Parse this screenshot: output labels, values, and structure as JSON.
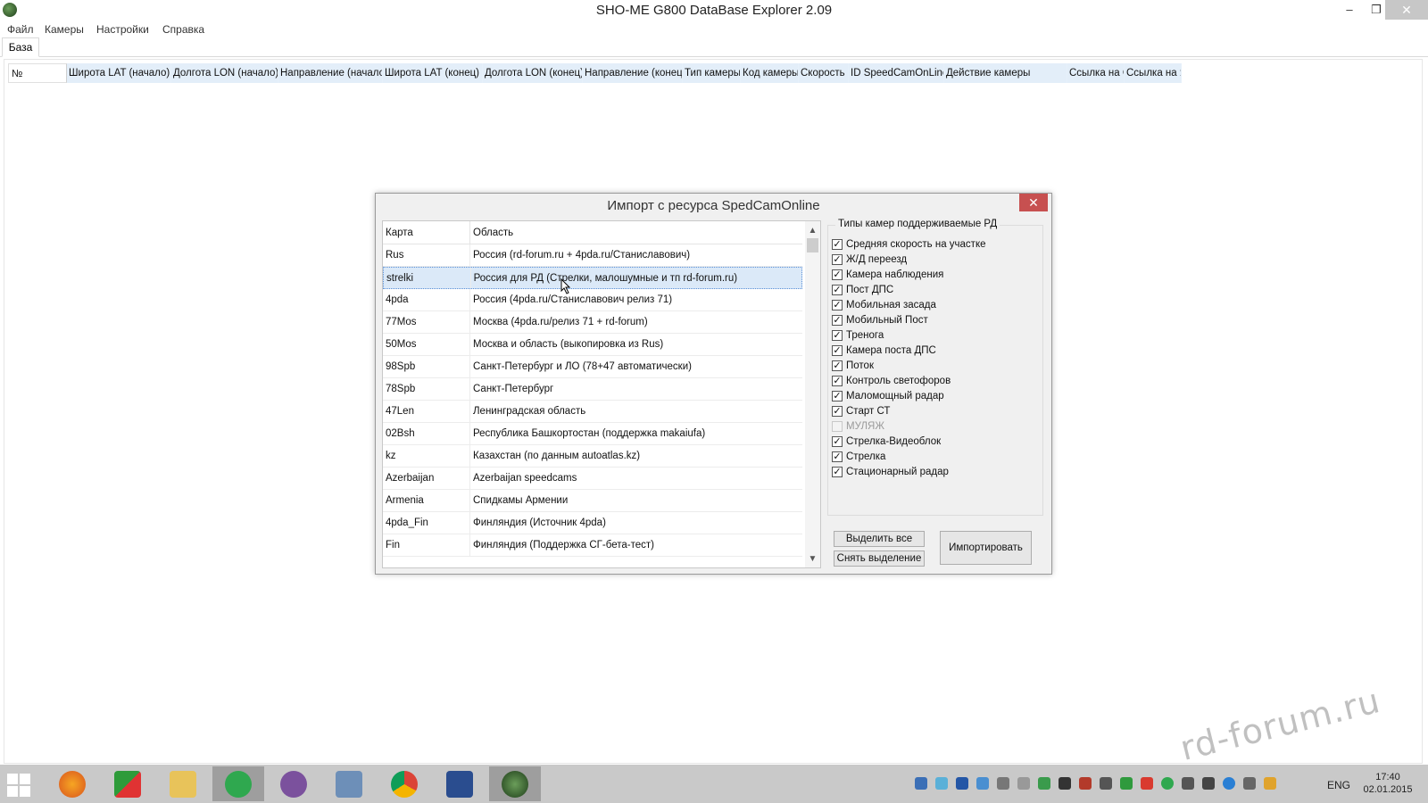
{
  "window": {
    "title": "SHO-ME G800 DataBase Explorer 2.09",
    "minimize": "–",
    "maximize": "❐",
    "close": "✕"
  },
  "menu": [
    "Файл",
    "Камеры",
    "Настройки",
    "Справка"
  ],
  "tabs": [
    "База"
  ],
  "grid": {
    "columns": [
      "№",
      "Широта LAT (начало)",
      "Долгота LON (начало)",
      "Направление (начало)",
      "Широта LAT (конец)",
      "Долгота LON (конец)",
      "Направление (конец)",
      "Тип камеры",
      "Код камеры",
      "Скорость",
      "ID SpeedCamOnLine",
      "Действие камеры",
      "Ссылка на G",
      "Ссылка на Я"
    ]
  },
  "dialog": {
    "title": "Импорт с ресурса SpedCamOnline",
    "close": "✕",
    "list_headers": [
      "Карта",
      "Область"
    ],
    "rows": [
      {
        "map": "Rus",
        "area": "Россия (rd-forum.ru + 4pda.ru/Станиславович)"
      },
      {
        "map": "strelki",
        "area": "Россия для РД (Стрелки, малошумные и тп rd-forum.ru)"
      },
      {
        "map": "4pda",
        "area": "Россия (4pda.ru/Станиславович релиз 71)"
      },
      {
        "map": "77Mos",
        "area": "Москва (4pda.ru/релиз 71 + rd-forum)"
      },
      {
        "map": "50Mos",
        "area": "Москва и область (выкопировка из Rus)"
      },
      {
        "map": "98Spb",
        "area": "Санкт-Петербург и ЛО (78+47 автоматически)"
      },
      {
        "map": "78Spb",
        "area": "Санкт-Петербург"
      },
      {
        "map": "47Len",
        "area": "Ленинградская область"
      },
      {
        "map": "02Bsh",
        "area": "Республика Башкортостан (поддержка makaiufa)"
      },
      {
        "map": "kz",
        "area": "Казахстан (по данным autoatlas.kz)"
      },
      {
        "map": "Azerbaijan",
        "area": "Azerbaijan speedcams"
      },
      {
        "map": "Armenia",
        "area": "Спидкамы Армении"
      },
      {
        "map": "4pda_Fin",
        "area": "Финляндия (Источник 4pda)"
      },
      {
        "map": "Fin",
        "area": "Финляндия (Поддержка СГ-бета-тест)"
      }
    ],
    "selected_row": "strelki",
    "scroll_up": "▲",
    "scroll_down": "▼",
    "types_legend": "Типы камер поддерживаемые РД",
    "types": [
      {
        "label": "Средняя скорость на участке",
        "checked": true
      },
      {
        "label": "Ж/Д переезд",
        "checked": true
      },
      {
        "label": "Камера наблюдения",
        "checked": true
      },
      {
        "label": "Пост ДПС",
        "checked": true
      },
      {
        "label": "Мобильная засада",
        "checked": true
      },
      {
        "label": "Мобильный Пост",
        "checked": true
      },
      {
        "label": "Тренога",
        "checked": true
      },
      {
        "label": "Камера поста ДПС",
        "checked": true
      },
      {
        "label": "Поток",
        "checked": true
      },
      {
        "label": "Контроль светофоров",
        "checked": true
      },
      {
        "label": "Маломощный радар",
        "checked": true
      },
      {
        "label": "Старт СТ",
        "checked": true
      },
      {
        "label": "МУЛЯЖ",
        "checked": false,
        "disabled": true
      },
      {
        "label": "Стрелка-Видеоблок",
        "checked": true
      },
      {
        "label": "Стрелка",
        "checked": true
      },
      {
        "label": "Стационарный радар",
        "checked": true
      }
    ],
    "select_all": "Выделить все",
    "clear_selection": "Снять выделение",
    "import": "Импортировать"
  },
  "watermark": "rd-forum.ru",
  "taskbar": {
    "apps": [
      "firefox-icon",
      "media-icon",
      "explorer-icon",
      "mail-agent-icon",
      "viber-icon",
      "keyboard-icon",
      "chrome-icon",
      "floppy-icon",
      "sho-me-icon"
    ],
    "language": "ENG",
    "time": "17:40",
    "date": "02.01.2015"
  },
  "colors": {
    "header_blue": "#e3eef9",
    "selection": "#dbe9f8",
    "close_red": "#c75050",
    "taskbar": "#c9c9c9"
  }
}
